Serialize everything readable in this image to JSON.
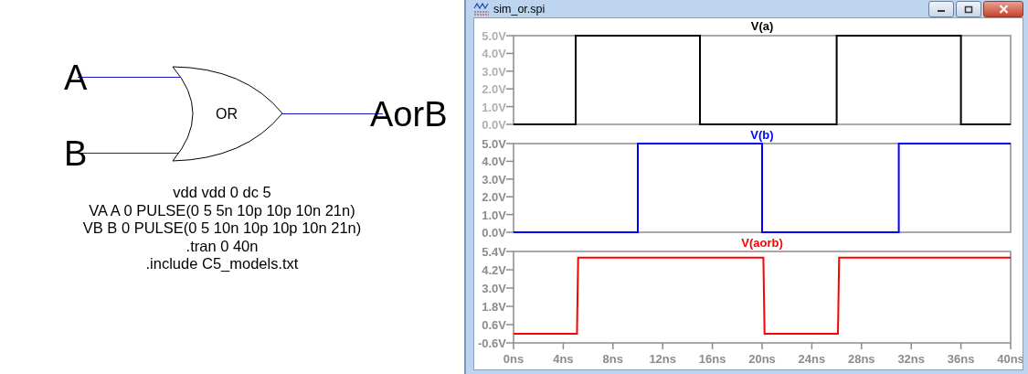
{
  "schematic": {
    "inputs": [
      {
        "label": "A"
      },
      {
        "label": "B"
      }
    ],
    "gate": {
      "label": "OR"
    },
    "output": {
      "label": "AorB"
    },
    "directives": [
      "vdd vdd 0 dc 5",
      "VA A 0 PULSE(0 5 5n 10p 10p 10n 21n)",
      "VB B 0 PULSE(0 5 10n 10p 10p 10n 21n)",
      ".tran 0 40n",
      ".include C5_models.txt"
    ]
  },
  "window": {
    "title": "sim_or.spi"
  },
  "plots": [
    {
      "chart_data": {
        "type": "line",
        "title": "V(a)",
        "x": [
          0,
          5,
          5,
          15,
          15,
          26,
          26,
          36,
          36,
          40
        ],
        "series": [
          {
            "color": "#000000",
            "values": [
              0,
              0,
              5,
              5,
              0,
              0,
              5,
              5,
              0,
              0
            ]
          }
        ],
        "xlim": [
          0,
          40
        ],
        "ylim": [
          0,
          5
        ],
        "yticks": [
          {
            "value": 0,
            "label": "0.0V"
          },
          {
            "value": 1,
            "label": "1.0V"
          },
          {
            "value": 2,
            "label": "2.0V"
          },
          {
            "value": 3,
            "label": "3.0V"
          },
          {
            "value": 4,
            "label": "4.0V"
          },
          {
            "value": 5,
            "label": "5.0V"
          }
        ]
      }
    },
    {
      "chart_data": {
        "type": "line",
        "title": "V(b)",
        "x": [
          0,
          10,
          10,
          20,
          20,
          31,
          31,
          40
        ],
        "series": [
          {
            "color": "#0000ff",
            "values": [
              0,
              0,
              5,
              5,
              0,
              0,
              5,
              5
            ]
          }
        ],
        "xlim": [
          0,
          40
        ],
        "ylim": [
          0,
          5
        ],
        "yticks": [
          {
            "value": 0,
            "label": "0.0V"
          },
          {
            "value": 1,
            "label": "1.0V"
          },
          {
            "value": 2,
            "label": "2.0V"
          },
          {
            "value": 3,
            "label": "3.0V"
          },
          {
            "value": 4,
            "label": "4.0V"
          },
          {
            "value": 5,
            "label": "5.0V"
          }
        ]
      }
    },
    {
      "chart_data": {
        "type": "line",
        "title": "V(aorb)",
        "x": [
          0,
          5.1,
          5.2,
          20.1,
          20.2,
          26.1,
          26.2,
          40
        ],
        "series": [
          {
            "color": "#ff0000",
            "values": [
              0,
              0,
              5,
              5,
              0,
              0,
              5,
              5
            ]
          }
        ],
        "xlim": [
          0,
          40
        ],
        "ylim": [
          -0.6,
          5.4
        ],
        "yticks": [
          {
            "value": -0.6,
            "label": "-0.6V"
          },
          {
            "value": 0.6,
            "label": "0.6V"
          },
          {
            "value": 1.8,
            "label": "1.8V"
          },
          {
            "value": 3,
            "label": "3.0V"
          },
          {
            "value": 4.2,
            "label": "4.2V"
          },
          {
            "value": 5.4,
            "label": "5.4V"
          }
        ],
        "xticks": [
          {
            "value": 0,
            "label": "0ns"
          },
          {
            "value": 4,
            "label": "4ns"
          },
          {
            "value": 8,
            "label": "8ns"
          },
          {
            "value": 12,
            "label": "12ns"
          },
          {
            "value": 16,
            "label": "16ns"
          },
          {
            "value": 20,
            "label": "20ns"
          },
          {
            "value": 24,
            "label": "24ns"
          },
          {
            "value": 28,
            "label": "28ns"
          },
          {
            "value": 32,
            "label": "32ns"
          },
          {
            "value": 36,
            "label": "36ns"
          },
          {
            "value": 40,
            "label": "40ns"
          }
        ]
      }
    }
  ]
}
